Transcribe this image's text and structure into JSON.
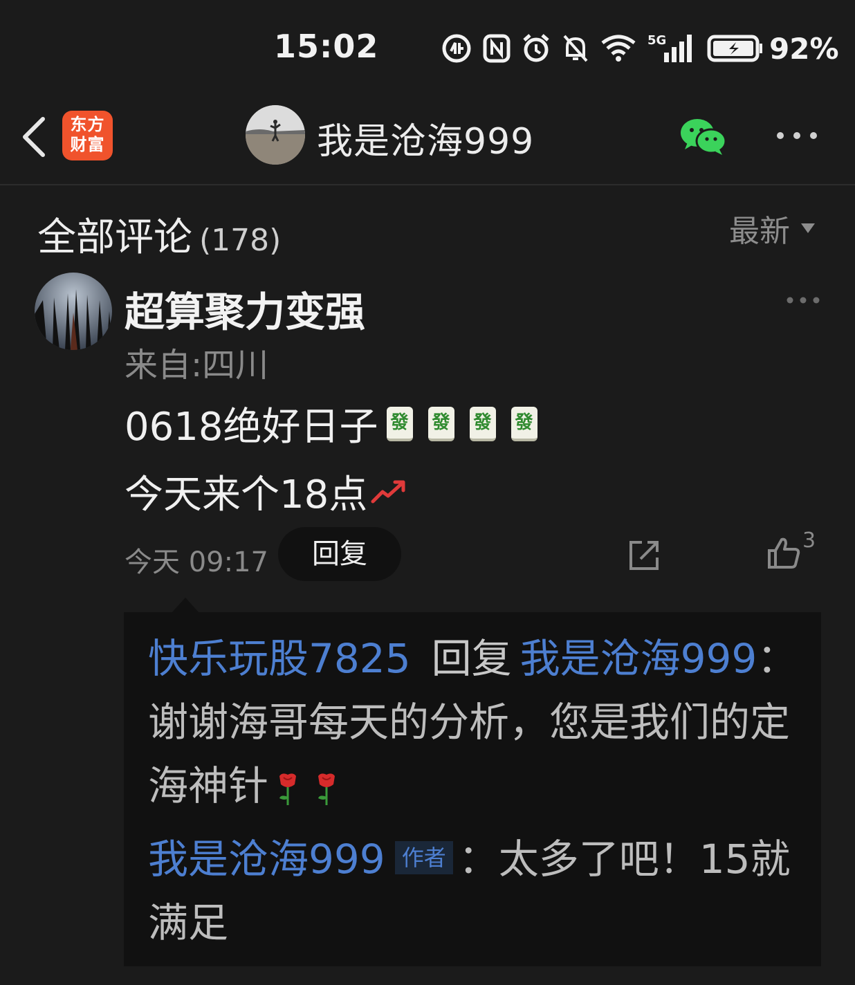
{
  "status_bar": {
    "time": "15:02",
    "network": "5G",
    "battery": "92%",
    "icons": [
      "hd-call-icon",
      "nfc-icon",
      "alarm-icon",
      "mute-icon",
      "wifi-icon",
      "signal-icon",
      "battery-icon"
    ]
  },
  "header": {
    "app_logo": "东方\n财富",
    "title": "我是沧海999",
    "icons": [
      "back-icon",
      "wechat-icon",
      "more-icon"
    ]
  },
  "comments_section": {
    "title": "全部评论",
    "count": "(178)",
    "sort_label": "最新"
  },
  "comment": {
    "username": "超算聚力变强",
    "location": "来自:四川",
    "line1": "0618绝好日子",
    "line1_emoji": [
      "發",
      "發",
      "發",
      "發"
    ],
    "line2": "今天来个18点",
    "time": "今天 09:17",
    "reply_label": "回复",
    "likes": "3"
  },
  "replies": [
    {
      "from": "快乐玩股7825",
      "reply_word": "回复",
      "to": "我是沧海999",
      "separator": "：",
      "text": "谢谢海哥每天的分析，您是我们的定海神针"
    },
    {
      "from": "我是沧海999",
      "badge": "作者",
      "separator": "：",
      "text": "太多了吧！15就满足"
    }
  ],
  "colors": {
    "background": "#1b1b1b",
    "reply_background": "#111111",
    "link_blue": "#4d7fd1",
    "brand_orange": "#f0532c",
    "wechat_green": "#3bd35b"
  }
}
